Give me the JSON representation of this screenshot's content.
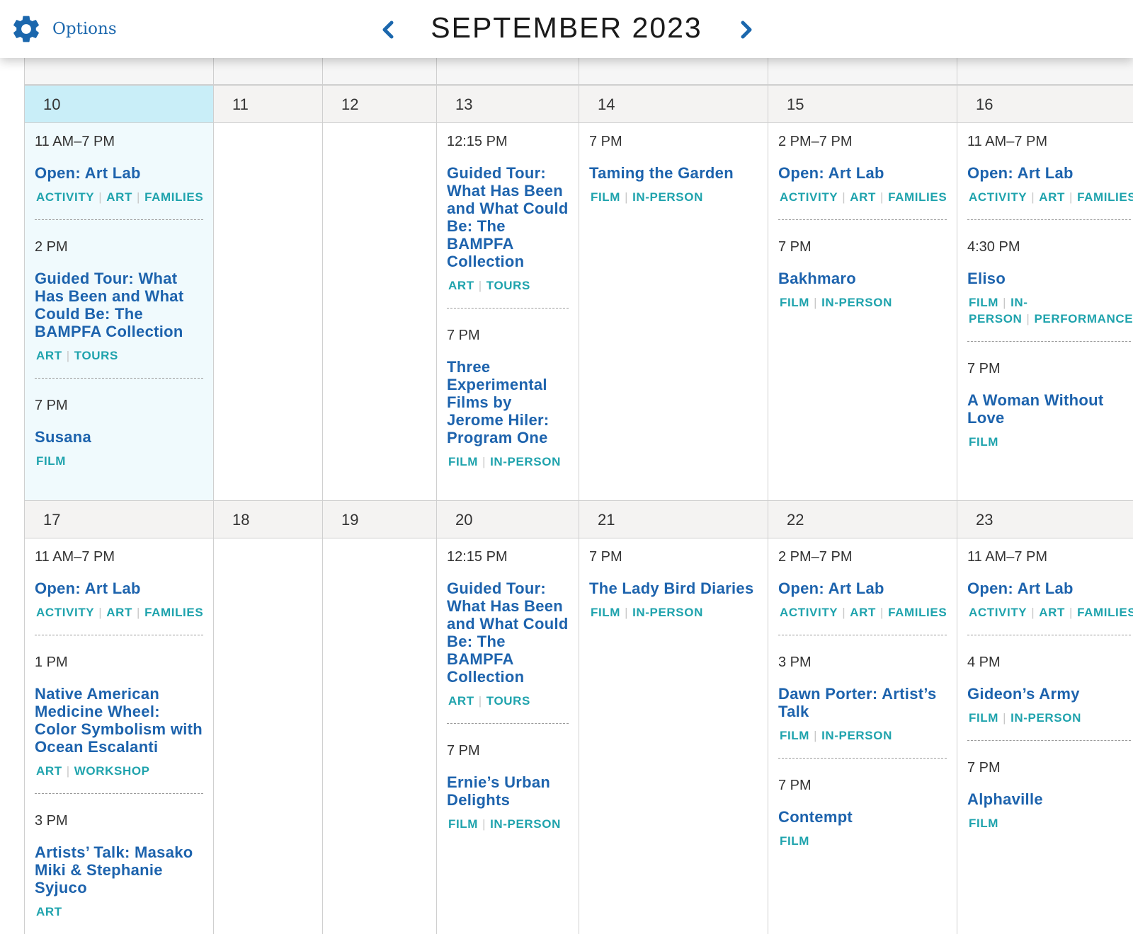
{
  "header": {
    "options_label": "Options",
    "month_title": "SEPTEMBER 2023",
    "prev_icon": "chevron-left-icon",
    "next_icon": "chevron-right-icon",
    "options_icon": "gear-icon"
  },
  "colors": {
    "accent_blue": "#1d63ad",
    "tag_teal": "#1fa3ad",
    "today_header": "#c9eef8",
    "today_body": "#f0fafd"
  },
  "weeks": [
    {
      "days": [
        {
          "day": "10",
          "today": true,
          "events": [
            {
              "time": "11 AM–7 PM",
              "title": "Open: Art Lab",
              "tags": [
                "ACTIVITY",
                "ART",
                "FAMILIES"
              ]
            },
            {
              "time": "2 PM",
              "title": "Guided Tour: What Has Been and What Could Be: The BAMPFA Collection",
              "tags": [
                "ART",
                "TOURS"
              ]
            },
            {
              "time": "7 PM",
              "title": "Susana",
              "tags": [
                "FILM"
              ]
            }
          ]
        },
        {
          "day": "11",
          "events": []
        },
        {
          "day": "12",
          "events": []
        },
        {
          "day": "13",
          "events": [
            {
              "time": "12:15 PM",
              "title": "Guided Tour: What Has Been and What Could Be: The BAMPFA Collection",
              "tags": [
                "ART",
                "TOURS"
              ]
            },
            {
              "time": "7 PM",
              "title": "Three Experimental Films by Jerome Hiler: Program One",
              "tags": [
                "FILM",
                "IN-PERSON"
              ]
            }
          ]
        },
        {
          "day": "14",
          "events": [
            {
              "time": "7 PM",
              "title": "Taming the Garden",
              "tags": [
                "FILM",
                "IN-PERSON"
              ]
            }
          ]
        },
        {
          "day": "15",
          "events": [
            {
              "time": "2 PM–7 PM",
              "title": "Open: Art Lab",
              "tags": [
                "ACTIVITY",
                "ART",
                "FAMILIES"
              ]
            },
            {
              "time": "7 PM",
              "title": "Bakhmaro",
              "tags": [
                "FILM",
                "IN-PERSON"
              ]
            }
          ]
        },
        {
          "day": "16",
          "events": [
            {
              "time": "11 AM–7 PM",
              "title": "Open: Art Lab",
              "tags": [
                "ACTIVITY",
                "ART",
                "FAMILIES"
              ]
            },
            {
              "time": "4:30 PM",
              "title": "Eliso",
              "tags": [
                "FILM",
                "IN-PERSON",
                "PERFORMANCE"
              ]
            },
            {
              "time": "7 PM",
              "title": "A Woman Without Love",
              "tags": [
                "FILM"
              ]
            }
          ]
        }
      ]
    },
    {
      "days": [
        {
          "day": "17",
          "events": [
            {
              "time": "11 AM–7 PM",
              "title": "Open: Art Lab",
              "tags": [
                "ACTIVITY",
                "ART",
                "FAMILIES"
              ]
            },
            {
              "time": "1 PM",
              "title": "Native American Medicine Wheel: Color Symbolism with Ocean Escalanti",
              "tags": [
                "ART",
                "WORKSHOP"
              ]
            },
            {
              "time": "3 PM",
              "title": "Artists’ Talk: Masako Miki & Stephanie Syjuco",
              "tags": [
                "ART"
              ]
            }
          ]
        },
        {
          "day": "18",
          "events": []
        },
        {
          "day": "19",
          "events": []
        },
        {
          "day": "20",
          "events": [
            {
              "time": "12:15 PM",
              "title": "Guided Tour: What Has Been and What Could Be: The BAMPFA Collection",
              "tags": [
                "ART",
                "TOURS"
              ]
            },
            {
              "time": "7 PM",
              "title": "Ernie’s Urban Delights",
              "tags": [
                "FILM",
                "IN-PERSON"
              ]
            }
          ]
        },
        {
          "day": "21",
          "events": [
            {
              "time": "7 PM",
              "title": "The Lady Bird Diaries",
              "tags": [
                "FILM",
                "IN-PERSON"
              ]
            }
          ]
        },
        {
          "day": "22",
          "events": [
            {
              "time": "2 PM–7 PM",
              "title": "Open: Art Lab",
              "tags": [
                "ACTIVITY",
                "ART",
                "FAMILIES"
              ]
            },
            {
              "time": "3 PM",
              "title": "Dawn Porter: Artist’s Talk",
              "tags": [
                "FILM",
                "IN-PERSON"
              ]
            },
            {
              "time": "7 PM",
              "title": "Contempt",
              "tags": [
                "FILM"
              ]
            }
          ]
        },
        {
          "day": "23",
          "events": [
            {
              "time": "11 AM–7 PM",
              "title": "Open: Art Lab",
              "tags": [
                "ACTIVITY",
                "ART",
                "FAMILIES"
              ]
            },
            {
              "time": "4 PM",
              "title": "Gideon’s Army",
              "tags": [
                "FILM",
                "IN-PERSON"
              ]
            },
            {
              "time": "7 PM",
              "title": "Alphaville",
              "tags": [
                "FILM"
              ]
            }
          ]
        }
      ]
    }
  ]
}
